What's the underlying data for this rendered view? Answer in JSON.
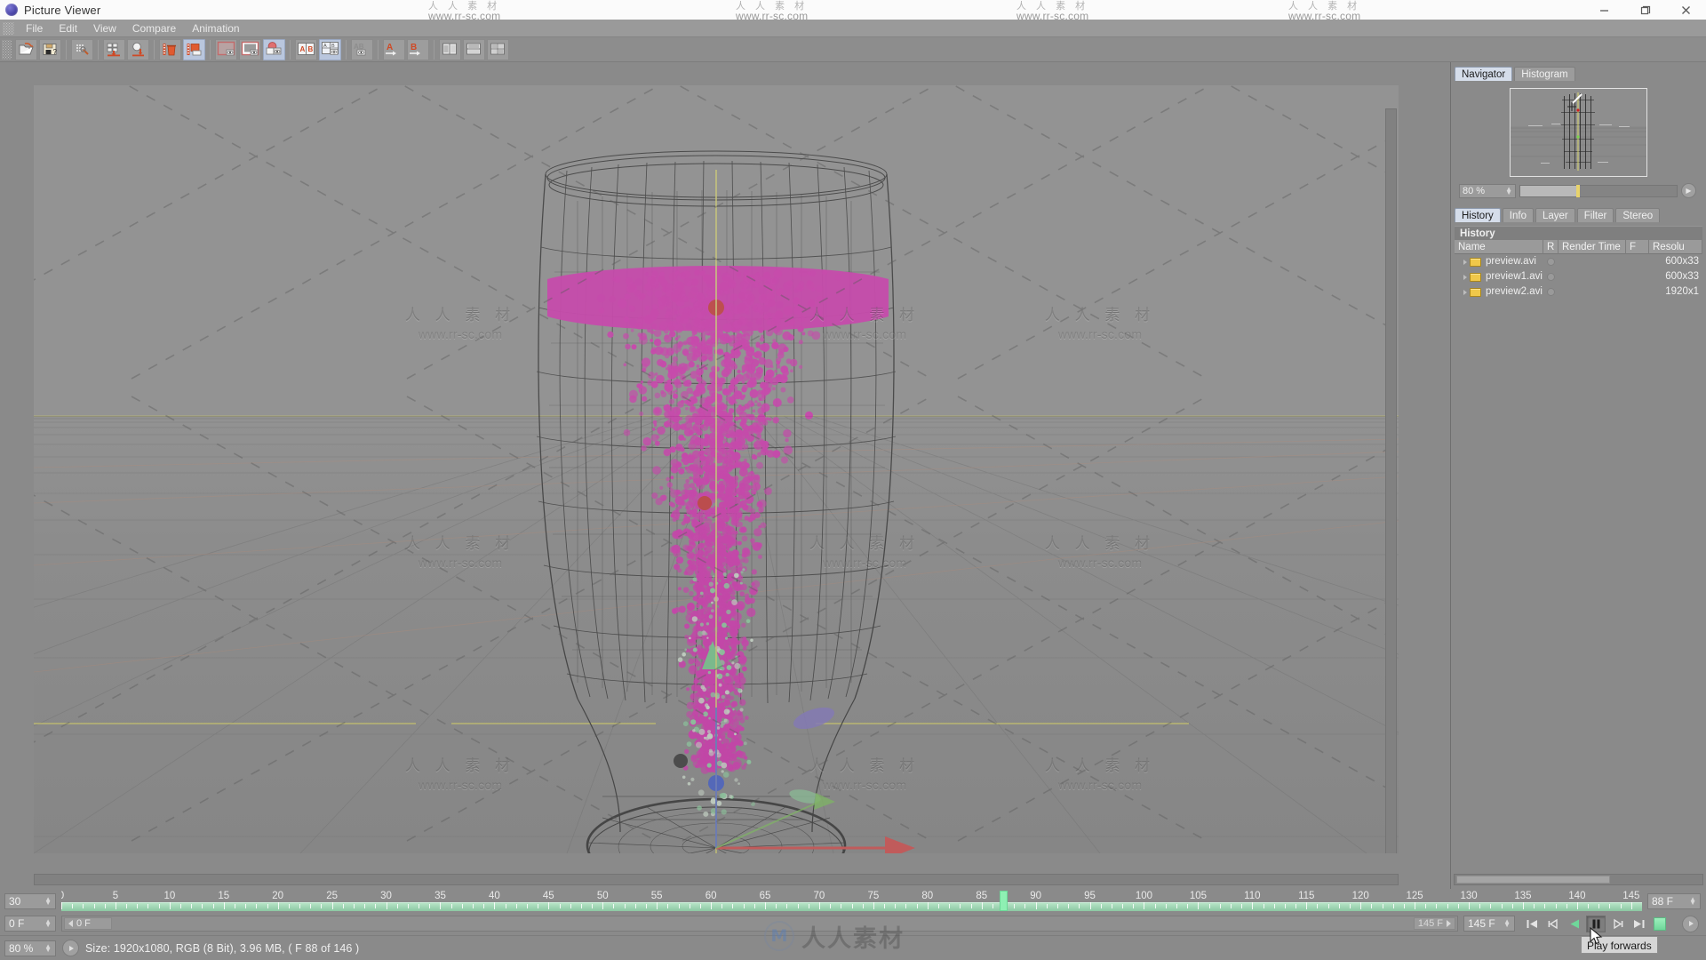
{
  "window": {
    "title": "Picture Viewer",
    "app_icon": "cinema4d-orb-icon",
    "controls": {
      "minimize": "minimize-icon",
      "maximize": "maximize-icon",
      "close": "close-icon"
    },
    "corner_logo": "ixpub"
  },
  "watermark": {
    "cn": "人 人 素 材",
    "url": "www.rr-sc.com",
    "logo_mark": "M",
    "logo_cn": "人人素材"
  },
  "menu": {
    "items": [
      "File",
      "Edit",
      "View",
      "Compare",
      "Animation"
    ]
  },
  "toolbar": {
    "groups": [
      {
        "tools": [
          {
            "name": "open-image-icon",
            "label": "Open Image",
            "active": false
          },
          {
            "name": "save-image-icon",
            "label": "Save Image",
            "active": false
          }
        ]
      },
      {
        "tools": [
          {
            "name": "settings-icon",
            "label": "Settings",
            "active": false
          }
        ]
      },
      {
        "tools": [
          {
            "name": "import-sequence-icon",
            "label": "Load Sequence",
            "active": false
          },
          {
            "name": "import-single-icon",
            "label": "Load Single Image",
            "active": false
          }
        ]
      },
      {
        "tools": [
          {
            "name": "delete-frame-icon",
            "label": "Delete",
            "active": false
          },
          {
            "name": "duplicate-frame-icon",
            "label": "Duplicate",
            "active": true
          }
        ]
      },
      {
        "tools": [
          {
            "name": "view-single-a-icon",
            "label": "Single View A",
            "active": false
          },
          {
            "name": "view-single-b-icon",
            "label": "Single View B",
            "active": false
          },
          {
            "name": "view-blend-icon",
            "label": "Blend View",
            "active": true
          }
        ]
      },
      {
        "tools": [
          {
            "name": "compare-ab-icon",
            "label": "Compare A|B",
            "active": false
          },
          {
            "name": "compare-quad-icon",
            "label": "Compare Quad",
            "active": true
          }
        ]
      },
      {
        "tools": [
          {
            "name": "compare-diff-icon",
            "label": "Difference",
            "active": false
          }
        ]
      },
      {
        "tools": [
          {
            "name": "assign-a-icon",
            "label": "Set A",
            "active": false
          },
          {
            "name": "assign-b-icon",
            "label": "Set B",
            "active": false
          }
        ]
      },
      {
        "tools": [
          {
            "name": "layout-ab-horizontal-icon",
            "label": "A|B Horizontal",
            "active": false
          },
          {
            "name": "layout-ab-vertical-icon",
            "label": "A|B Vertical",
            "active": false
          },
          {
            "name": "layout-ab-quad-icon",
            "label": "A|B Quad",
            "active": false
          }
        ]
      }
    ]
  },
  "navigator": {
    "tabs": [
      {
        "label": "Navigator",
        "selected": true
      },
      {
        "label": "Histogram",
        "selected": false
      }
    ],
    "zoom_value": "80 %",
    "play_icon": "play-icon"
  },
  "inspector": {
    "tabs": [
      {
        "label": "History",
        "selected": true
      },
      {
        "label": "Info",
        "selected": false
      },
      {
        "label": "Layer",
        "selected": false
      },
      {
        "label": "Filter",
        "selected": false
      },
      {
        "label": "Stereo",
        "selected": false
      }
    ],
    "section_title": "History",
    "columns": [
      "Name",
      "R",
      "Render Time",
      "F",
      "Resolu"
    ],
    "rows": [
      {
        "name": "preview.avi",
        "r": "",
        "render_time": "",
        "f": "",
        "resolution": "600x33"
      },
      {
        "name": "preview1.avi",
        "r": "",
        "render_time": "",
        "f": "",
        "resolution": "600x33"
      },
      {
        "name": "preview2.avi",
        "r": "",
        "render_time": "",
        "f": "",
        "resolution": "1920x1"
      }
    ]
  },
  "timeline": {
    "fps_value": "30",
    "current_frame_value": "0 F",
    "scrub_left_label": "0 F",
    "scrub_right_label": "145 F",
    "end_frame_value": "145 F",
    "frame_counter": "88 F",
    "playhead_frame": 87,
    "range_start": 0,
    "range_end": 146,
    "tick_labels": [
      0,
      5,
      10,
      15,
      20,
      25,
      30,
      35,
      40,
      45,
      50,
      55,
      60,
      65,
      70,
      75,
      80,
      85,
      90,
      95,
      100,
      105,
      110,
      115,
      120,
      125,
      130,
      135,
      140,
      145
    ],
    "transport": [
      {
        "name": "go-to-start-button",
        "icon": "skip-back-icon",
        "pressed": false
      },
      {
        "name": "step-back-button",
        "icon": "step-back-icon",
        "pressed": false
      },
      {
        "name": "play-backwards-button",
        "icon": "play-back-icon",
        "pressed": false
      },
      {
        "name": "play-forwards-button",
        "icon": "pause-icon",
        "pressed": true
      },
      {
        "name": "step-forward-button",
        "icon": "step-forward-icon",
        "pressed": false
      },
      {
        "name": "go-to-end-button",
        "icon": "skip-forward-icon",
        "pressed": false
      },
      {
        "name": "loop-button",
        "icon": "loop-block-icon",
        "pressed": false
      }
    ],
    "tooltip": "Play forwards"
  },
  "statusbar": {
    "zoom_value": "80 %",
    "info": "Size: 1920x1080, RGB (8 Bit), 3.96 MB,  ( F 88 of 146 )"
  },
  "viewport": {
    "scene": "wireframe drinking glass with magenta particle fluid",
    "gizmo": {
      "x_axis_color": "#f03a3a",
      "y_axis_color": "#7ad64e",
      "z_axis_color": "#3a5cf0"
    },
    "particle_color": "#f012c0",
    "highlight_points": [
      "#e01818",
      "#e01818",
      "#2a4fe0",
      "#6be06b"
    ]
  }
}
